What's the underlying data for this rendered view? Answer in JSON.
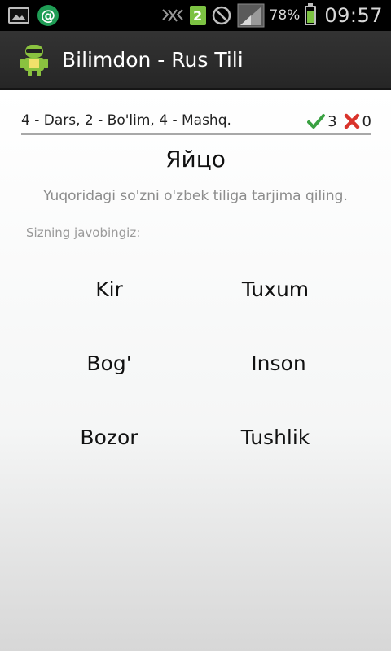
{
  "status_bar": {
    "icons_left": [
      "gallery-icon",
      "email-at-icon"
    ],
    "sim_number": "2",
    "battery_percent": "78%",
    "battery_level": 0.78,
    "time": "09:57"
  },
  "action_bar": {
    "title": "Bilimdon - Rus Tili"
  },
  "lesson": {
    "position_text": "4 - Dars, 2 - Bo'lim, 4 - Mashq.",
    "correct_count": "3",
    "wrong_count": "0"
  },
  "question": {
    "word": "Яйцо",
    "instruction": "Yuqoridagi so'zni o'zbek tiliga tarjima qiling.",
    "answer_label": "Sizning javobingiz:"
  },
  "options": [
    "Kir",
    "Tuxum",
    "Bog'",
    "Inson",
    "Bozor",
    "Tushlik"
  ],
  "colors": {
    "status_bar_bg": "#000000",
    "action_bar_bg": "#2d2d2d",
    "correct_green": "#3aa142",
    "wrong_red": "#d9332b",
    "battery_green": "#7cc242"
  }
}
